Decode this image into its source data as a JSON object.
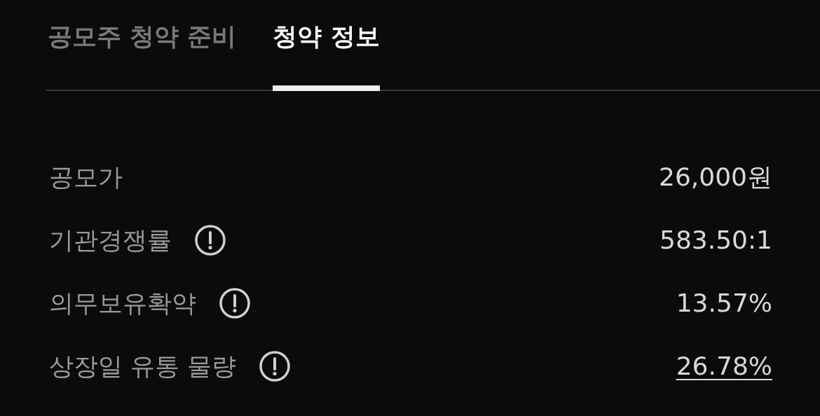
{
  "tabs": [
    {
      "label": "공모주 청약 준비",
      "selected": false
    },
    {
      "label": "청약 정보",
      "selected": true
    }
  ],
  "rows": [
    {
      "label": "공모가",
      "value": "26,000원",
      "info": false,
      "link": false
    },
    {
      "label": "기관경쟁률",
      "value": "583.50:1",
      "info": true,
      "link": false
    },
    {
      "label": "의무보유확약",
      "value": "13.57%",
      "info": true,
      "link": false
    },
    {
      "label": "상장일 유통 물량",
      "value": "26.78%",
      "info": true,
      "link": true
    }
  ]
}
